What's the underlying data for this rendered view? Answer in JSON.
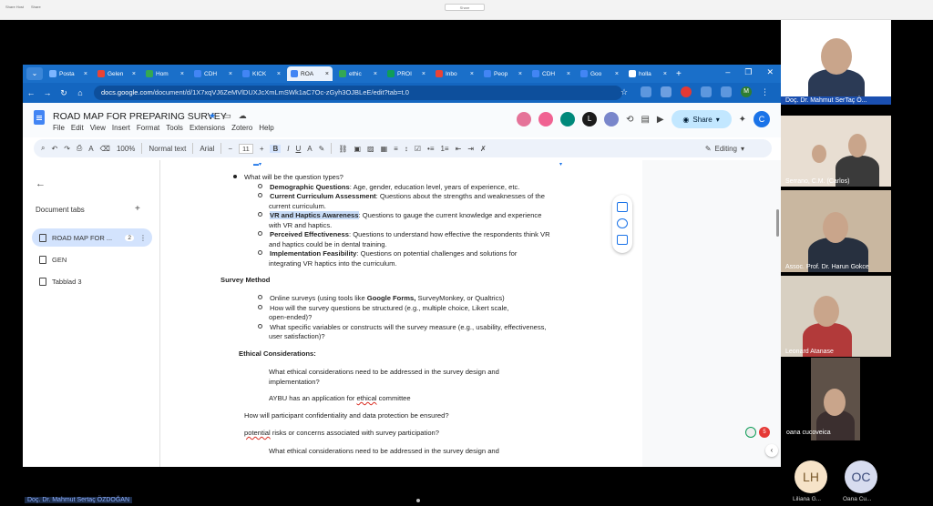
{
  "host": {
    "strip_left": [
      "Share Host",
      "Share"
    ],
    "strip_center": "Share"
  },
  "browser": {
    "tabs": [
      {
        "label": "Posta",
        "color": "#7cb5ff"
      },
      {
        "label": "Gelen",
        "color": "#ea4335"
      },
      {
        "label": "Hom",
        "color": "#34a853"
      },
      {
        "label": "CDH",
        "color": "#4285f4"
      },
      {
        "label": "KICK",
        "color": "#4285f4"
      },
      {
        "label": "ROA",
        "color": "#4285f4",
        "active": true
      },
      {
        "label": "ethic",
        "color": "#34a853"
      },
      {
        "label": "PROI",
        "color": "#0f9d58"
      },
      {
        "label": "Inbo",
        "color": "#ea4335"
      },
      {
        "label": "Peop",
        "color": "#4285f4"
      },
      {
        "label": "CDH",
        "color": "#4285f4"
      },
      {
        "label": "Goo",
        "color": "#4285f4"
      },
      {
        "label": "holla",
        "color": "#ffffff"
      }
    ],
    "url_host": "docs.google.com",
    "url_path": "/document/d/1X7xqVJ6ZeMVlDUXJcXmLmSWk1aC7Oc-zGyh3OJBLeE/edit?tab=t.0",
    "profile_initial": "M"
  },
  "docs": {
    "title": "ROAD MAP FOR PREPARING SURVEY",
    "menus": [
      "File",
      "Edit",
      "View",
      "Insert",
      "Format",
      "Tools",
      "Extensions",
      "Zotero",
      "Help"
    ],
    "share_label": "Share",
    "user_initial": "C",
    "collab_initial": "L",
    "toolbar": {
      "zoom": "100%",
      "style": "Normal text",
      "font": "Arial",
      "size": "11",
      "mode": "Editing"
    },
    "outline": {
      "title": "Document tabs",
      "tabs": [
        {
          "label": "ROAD MAP FOR ...",
          "badge": "2",
          "active": true
        },
        {
          "label": "GEN"
        },
        {
          "label": "Tabblad 3"
        }
      ]
    },
    "content": {
      "question_types": "What will be the question types?",
      "demo_b": "Demographic Questions",
      "demo_t": ": Age, gender, education level, years of experience, etc.",
      "curr_b": "Current Curriculum Assessment",
      "curr_t": ": Questions about the strengths and weaknesses of the",
      "curr_t2": "current curriculum.",
      "vr_b": "VR and Haptics Awareness",
      "vr_t": ": Questions to gauge the current knowledge and experience",
      "vr_t2": "with VR and haptics.",
      "perc_b": "Perceived Effectiveness",
      "perc_t": ": Questions to understand how effective the respondents think VR",
      "perc_t2": "and haptics could be in dental training.",
      "impl_b": "Implementation Feasibility",
      "impl_t": ": Questions on potential challenges and solutions for",
      "impl_t2": "integrating VR haptics into the curriculum.",
      "survey_method": "Survey Method",
      "online_a": "Online surveys (using tools like ",
      "online_b": "Google Forms,",
      "online_c": " SurveyMonkey, or Qualtrics)",
      "structured": "How will the survey questions be structured (e.g., multiple choice, Likert scale,",
      "structured2": "open-ended)?",
      "variables": "What specific variables or constructs will the survey measure (e.g., usability, effectiveness,",
      "variables2": "user satisfaction)?",
      "ethical_heading": "Ethical Considerations:",
      "ethical_q": "What ethical considerations need to be addressed in the survey design and",
      "ethical_q2": "implementation?",
      "aybu_a": "AYBU has an application for ",
      "aybu_b": "ethical",
      "aybu_c": " committee",
      "confidentiality": "How will participant confidentiality and data protection be ensured?",
      "risks_a": "potential",
      "risks_b": " risks or concerns associated with survey participation?",
      "ethical_q_repeat": "What ethical considerations need to be addressed in the survey design and"
    },
    "comment_count": "5"
  },
  "participants": [
    {
      "name": "Doç. Dr. Mahmut SerTaç Ö...",
      "shirt": "#2b3a55"
    },
    {
      "name": "Serrano, C.M. (Carlos)",
      "shirt": "#3a3a3a"
    },
    {
      "name": "Assoc. Prof. Dr. Harun Gokce",
      "shirt": "#27303f"
    },
    {
      "name": "Leonard Atanase",
      "shirt": "#b23a3a"
    },
    {
      "name": "oana cucoveica",
      "shirt": "#3b2f2f"
    }
  ],
  "avatars": [
    {
      "initials": "LH",
      "name": "Liliana G...",
      "bg": "#f6e3c8",
      "fg": "#7a5a2c"
    },
    {
      "initials": "OC",
      "name": "Oana Cu...",
      "bg": "#d7dcef",
      "fg": "#3b4a7a"
    }
  ],
  "presenter": "Doç. Dr. Mahmut Sertaç ÖZDOĞAN"
}
